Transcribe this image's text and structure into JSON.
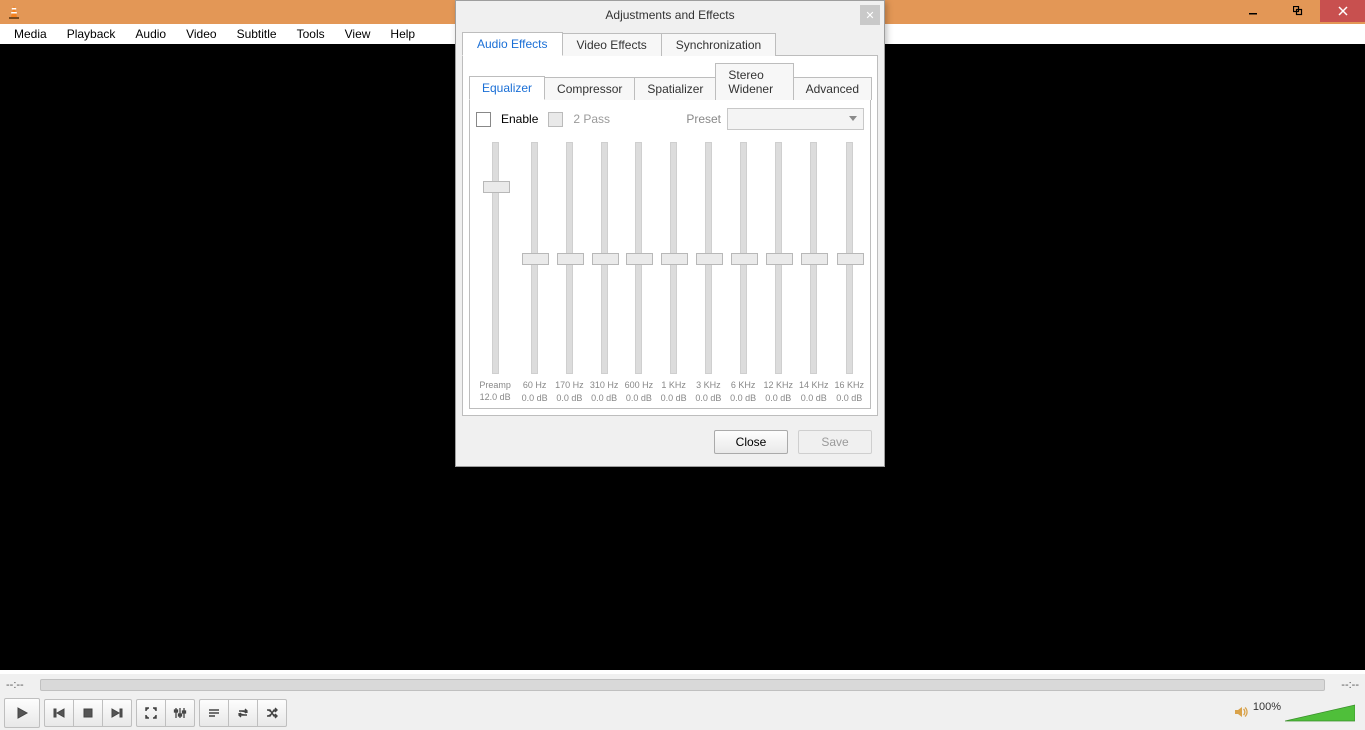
{
  "menus": {
    "m0": "Media",
    "m1": "Playback",
    "m2": "Audio",
    "m3": "Video",
    "m4": "Subtitle",
    "m5": "Tools",
    "m6": "View",
    "m7": "Help"
  },
  "time": {
    "left": "--:--",
    "right": "--:--"
  },
  "volume": {
    "percent": "100%"
  },
  "dialog": {
    "title": "Adjustments and Effects",
    "topTabs": {
      "t0": "Audio Effects",
      "t1": "Video Effects",
      "t2": "Synchronization"
    },
    "innerTabs": {
      "i0": "Equalizer",
      "i1": "Compressor",
      "i2": "Spatializer",
      "i3": "Stereo Widener",
      "i4": "Advanced"
    },
    "enable": "Enable",
    "twoPass": "2 Pass",
    "presetLabel": "Preset",
    "preamp": {
      "label": "Preamp",
      "db": "12.0 dB"
    },
    "bands": {
      "b0": {
        "freq": "60 Hz",
        "db": "0.0 dB"
      },
      "b1": {
        "freq": "170 Hz",
        "db": "0.0 dB"
      },
      "b2": {
        "freq": "310 Hz",
        "db": "0.0 dB"
      },
      "b3": {
        "freq": "600 Hz",
        "db": "0.0 dB"
      },
      "b4": {
        "freq": "1 KHz",
        "db": "0.0 dB"
      },
      "b5": {
        "freq": "3 KHz",
        "db": "0.0 dB"
      },
      "b6": {
        "freq": "6 KHz",
        "db": "0.0 dB"
      },
      "b7": {
        "freq": "12 KHz",
        "db": "0.0 dB"
      },
      "b8": {
        "freq": "14 KHz",
        "db": "0.0 dB"
      },
      "b9": {
        "freq": "16 KHz",
        "db": "0.0 dB"
      }
    },
    "close": "Close",
    "save": "Save"
  }
}
